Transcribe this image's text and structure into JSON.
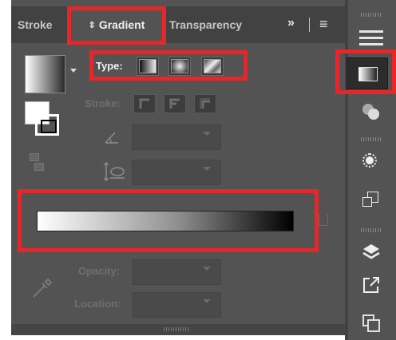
{
  "tabs": {
    "stroke": "Stroke",
    "gradient": "Gradient",
    "transparency": "Transparency",
    "overflow": "»",
    "menu": "≡",
    "updown_glyph": "⇕"
  },
  "type_row": {
    "label": "Type:",
    "buttons": [
      {
        "name": "linear-gradient-icon"
      },
      {
        "name": "radial-gradient-icon"
      },
      {
        "name": "freeform-gradient-icon"
      }
    ]
  },
  "stroke_row": {
    "label": "Stroke:"
  },
  "angle": {
    "icon": "angle-icon",
    "value": ""
  },
  "aspect_ratio": {
    "icon": "aspect-ratio-icon",
    "value": ""
  },
  "gradient_slider": {
    "stops": [
      "#ffffff",
      "#000000"
    ]
  },
  "opacity": {
    "label": "Opacity:",
    "value": ""
  },
  "location": {
    "label": "Location:",
    "value": ""
  },
  "colors": {
    "panel_bg": "#535353",
    "tabbar_bg": "#424242",
    "highlight": "#e8262a"
  },
  "right_strip": {
    "icons": [
      "menu-icon",
      "gradient-panel-icon",
      "transparency-panel-icon",
      "appearance-icon",
      "transform-icon",
      "layers-icon",
      "export-icon",
      "artboards-icon"
    ]
  }
}
